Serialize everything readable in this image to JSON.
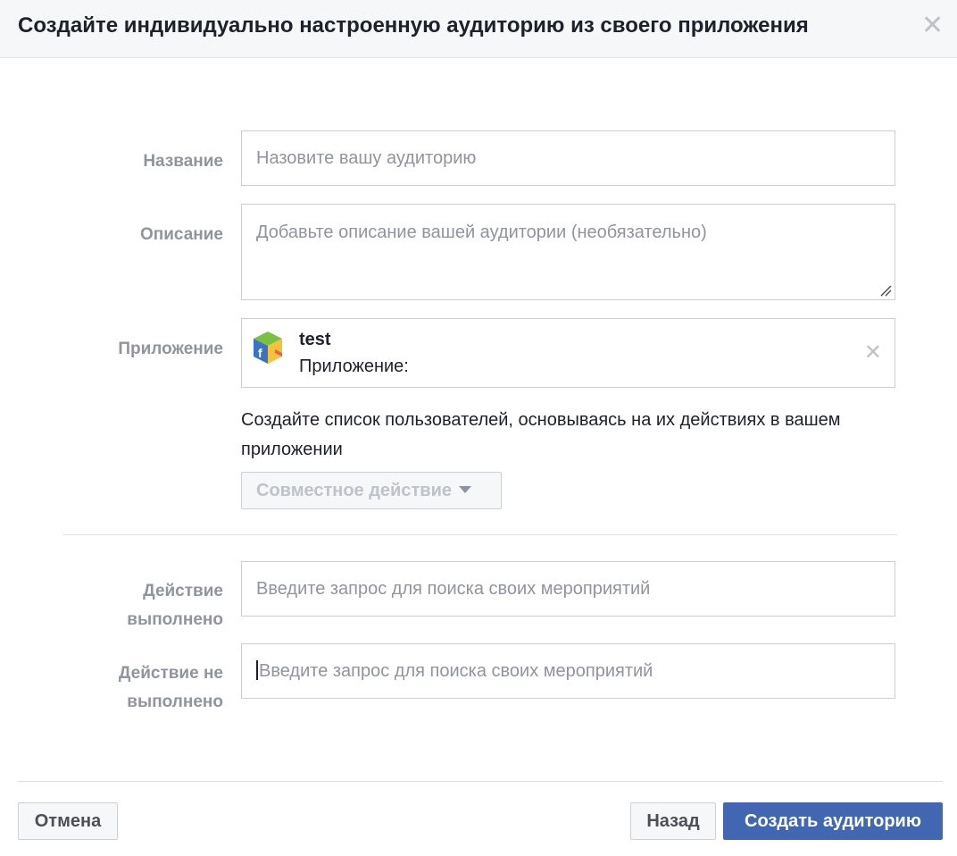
{
  "dialog": {
    "title": "Создайте индивидуально настроенную аудиторию из своего приложения",
    "close_glyph": "✕"
  },
  "form": {
    "name": {
      "label": "Название",
      "placeholder": "Назовите вашу аудиторию"
    },
    "description": {
      "label": "Описание",
      "placeholder": "Добавьте описание вашей аудитории (необязательно)"
    },
    "app": {
      "label": "Приложение",
      "name": "test",
      "subtitle": "Приложение:",
      "remove_glyph": "✕"
    },
    "hint": "Создайте список пользователей, основываясь на их действиях в вашем приложении",
    "event_dropdown": {
      "label": "Совместное действие"
    },
    "action_done": {
      "label_line1": "Действие",
      "label_line2": "выполнено",
      "placeholder": "Введите запрос для поиска своих мероприятий"
    },
    "action_not_done": {
      "label_line1": "Действие не",
      "label_line2": "выполнено",
      "placeholder": "Введите запрос для поиска своих мероприятий"
    }
  },
  "footer": {
    "cancel_label": "Отмена",
    "back_label": "Назад",
    "create_label": "Создать аудиторию"
  },
  "colors": {
    "primary": "#4267b2",
    "label_gray": "#90949c",
    "border": "#ccd0d5"
  }
}
